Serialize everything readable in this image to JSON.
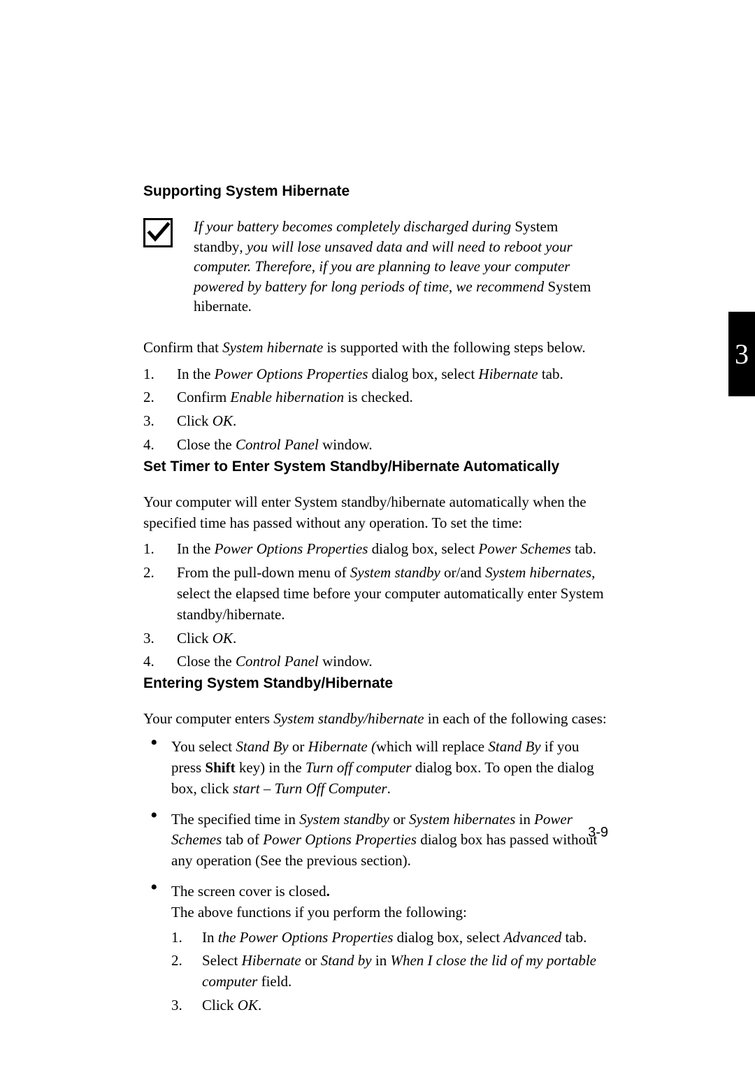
{
  "chapter_tab": "3",
  "page_number": "3-9",
  "sections": {
    "s1_title": "Supporting System Hibernate",
    "s2_title": "Set Timer to Enter System Standby/Hibernate Automatically",
    "s3_title": "Entering System Standby/Hibernate"
  },
  "note": {
    "p1a": "If your battery becomes completely discharged during ",
    "p1b": "System standby",
    "p1c": ", you will lose unsaved data and will need to reboot your computer. Therefore, if you are planning to leave your computer powered by battery for long periods of time, we recommend ",
    "p1d": "System hibernate",
    "p1e": "."
  },
  "confirm": {
    "intro_a": "Confirm that ",
    "intro_b": "System hibernate",
    "intro_c": " is supported with the following steps below.",
    "li1_a": "In the ",
    "li1_b": "Power Options Properties",
    "li1_c": " dialog box, select ",
    "li1_d": "Hibernate",
    "li1_e": " tab.",
    "li2_a": "Confirm ",
    "li2_b": "Enable hibernation",
    "li2_c": " is checked.",
    "li3_a": "Click ",
    "li3_b": "OK",
    "li3_c": ".",
    "li4_a": "Close the ",
    "li4_b": "Control Panel",
    "li4_c": " window."
  },
  "timer": {
    "intro": "Your computer will enter System standby/hibernate automatically when the specified time has passed without any operation. To set the time:",
    "li1_a": "In the ",
    "li1_b": "Power Options Properties",
    "li1_c": " dialog box, select ",
    "li1_d": "Power Schemes",
    "li1_e": " tab.",
    "li2_a": "From the pull-down menu of ",
    "li2_b": "System standby",
    "li2_c": " or/and ",
    "li2_d": "System hibernates,",
    "li2_e": " select the elapsed time before your computer automatically enter System standby/hibernate.",
    "li3_a": "Click ",
    "li3_b": "OK",
    "li3_c": ".",
    "li4_a": "Close the ",
    "li4_b": "Control Panel",
    "li4_c": " window."
  },
  "entering": {
    "intro_a": "Your computer enters ",
    "intro_b": "System standby/hibernate",
    "intro_c": " in each of the following cases:",
    "b1_a": "You select ",
    "b1_b": "Stand By",
    "b1_c": " or ",
    "b1_d": "Hibernate (",
    "b1_e": "which will replace ",
    "b1_f": "Stand By",
    "b1_g": " if you press ",
    "b1_h": "Shift",
    "b1_i": " key) in the ",
    "b1_j": "Turn off computer",
    "b1_k": " dialog box. To open the dialog box, click ",
    "b1_l": "start – Turn Off Computer",
    "b1_m": ".",
    "b2_a": "The specified time in ",
    "b2_b": "System standby",
    "b2_c": " or ",
    "b2_d": "System hibernates",
    "b2_e": " in ",
    "b2_f": "Power Schemes",
    "b2_g": " tab of ",
    "b2_h": "Power Options Properties",
    "b2_i": " dialog box has passed without any operation (See the previous section).",
    "b3_a": "The screen cover is closed",
    "b3_b": ".",
    "b3_c": "The above functions if you perform the following:",
    "b3_li1_a": "In ",
    "b3_li1_b": "the Power Options Properties",
    "b3_li1_c": " dialog box, select ",
    "b3_li1_d": "Advanced",
    "b3_li1_e": " tab.",
    "b3_li2_a": "Select ",
    "b3_li2_b": "Hibernate",
    "b3_li2_c": " or ",
    "b3_li2_d": "Stand by",
    "b3_li2_e": " in ",
    "b3_li2_f": "When I close the lid of my portable computer",
    "b3_li2_g": " field.",
    "b3_li3_a": "Click ",
    "b3_li3_b": "OK",
    "b3_li3_c": "."
  }
}
